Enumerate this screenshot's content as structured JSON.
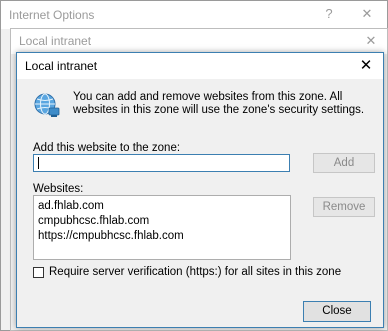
{
  "background_window": {
    "title": "Internet Options",
    "help_label": "?",
    "close_label": "✕"
  },
  "intranet_window": {
    "title": "Local intranet",
    "close_label": "✕"
  },
  "dialog": {
    "title": "Local intranet",
    "close_label": "✕",
    "icon": "globe-network-icon",
    "intro_text": "You can add and remove websites from this zone. All websites in this zone will use the zone's security settings.",
    "add_label": "Add this website to the zone:",
    "add_input_value": "",
    "add_button": "Add",
    "websites_label": "Websites:",
    "websites": [
      "ad.fhlab.com",
      "cmpubhcsc.fhlab.com",
      "https://cmpubhcsc.fhlab.com"
    ],
    "remove_button": "Remove",
    "require_https_label": "Require server verification (https:) for all sites in this zone",
    "require_https_checked": false,
    "close_button": "Close"
  },
  "colors": {
    "accent_border": "#3c7fb1",
    "dialog_bg": "#f0f0f0",
    "disabled_text": "#8a8a8a"
  }
}
